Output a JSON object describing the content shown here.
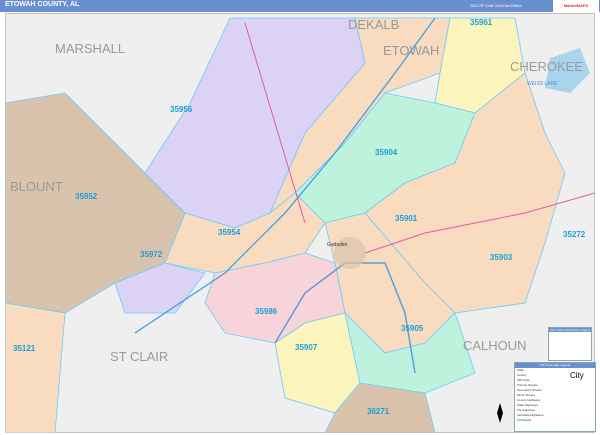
{
  "header": {
    "title": "ETOWAH COUNTY, AL",
    "edition": "2022 ZIP Code ColorCast Edition",
    "logo": "MarketMAPS"
  },
  "counties": [
    "MARSHALL",
    "DEKALB",
    "ETOWAH",
    "CHEROKEE",
    "BLOUNT",
    "ST CLAIR",
    "CALHOUN"
  ],
  "lake": "WEISS LAKE",
  "city": "Gadsden",
  "zips": [
    "35961",
    "35956",
    "35904",
    "35952",
    "35901",
    "35954",
    "35972",
    "35903",
    "35272",
    "35986",
    "35905",
    "35907",
    "35121",
    "36271"
  ],
  "ziplist_title": "ZIP Code Index/Color Legend",
  "legend": {
    "title": "ZIP Code Map Legend",
    "items": [
      "State",
      "County",
      "ZIP Code",
      "Primary Streets",
      "Secondary Streets",
      "Minor Streets",
      "County Highways",
      "State Highways",
      "US Highways",
      "Interstate Highways",
      "Toll Roads"
    ],
    "city_label": "City"
  },
  "colors": {
    "lavender": "#dcd2f5",
    "tan": "#d9c3ad",
    "peach": "#f9dcbf",
    "mint": "#bff2dc",
    "pink": "#f8d3da",
    "yellow": "#fbf4bd",
    "outside": "#efefef"
  }
}
